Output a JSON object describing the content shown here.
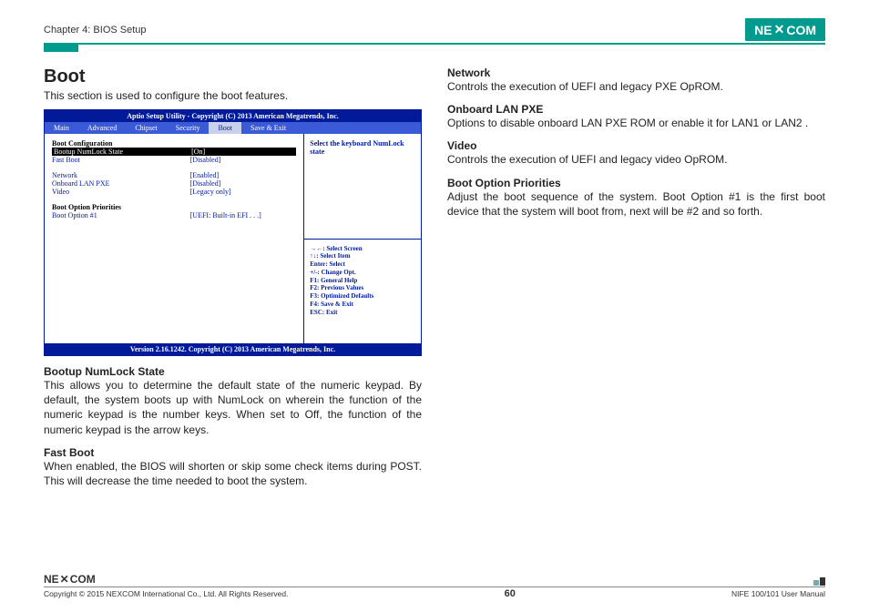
{
  "header": {
    "chapter": "Chapter 4: BIOS Setup",
    "logo_pre": "NE",
    "logo_x": "✕",
    "logo_post": "COM"
  },
  "left": {
    "h1": "Boot",
    "intro": "This section is used to configure the boot features.",
    "numlock_h": "Bootup NumLock State",
    "numlock_b": "This allows you to determine the default state of the numeric keypad. By default, the system boots up with NumLock on wherein the function of the numeric keypad is the number keys. When set to Off, the function of the numeric keypad is the arrow keys.",
    "fastboot_h": "Fast Boot",
    "fastboot_b": "When enabled, the BIOS will shorten or skip some check items during POST. This will decrease the time needed to boot the system."
  },
  "right": {
    "network_h": "Network",
    "network_b": "Controls the execution of UEFI and legacy PXE OpROM.",
    "lanpxe_h": "Onboard LAN PXE",
    "lanpxe_b": "Options to disable onboard LAN PXE ROM or enable it for LAN1 or LAN2 .",
    "video_h": "Video",
    "video_b": "Controls the execution of UEFI and legacy video OpROM.",
    "priorities_h": "Boot Option Priorities",
    "priorities_b": "Adjust the boot sequence of the system. Boot Option #1 is the first boot device that the system will boot from, next will be #2 and so forth."
  },
  "bios": {
    "title": "Aptio Setup Utility - Copyright (C) 2013 American Megatrends, Inc.",
    "tabs": {
      "main": "Main",
      "advanced": "Advanced",
      "chipset": "Chipset",
      "security": "Security",
      "boot": "Boot",
      "save": "Save & Exit"
    },
    "cfg_header": "Boot Configuration",
    "rows": {
      "numlock_k": "Bootup NumLock State",
      "numlock_v": "[On]",
      "fast_k": "Fast Boot",
      "fast_v": "[Disabled]",
      "net_k": "Network",
      "net_v": "[Enabled]",
      "lan_k": "Onboard LAN PXE",
      "lan_v": "[Disabled]",
      "vid_k": "Video",
      "vid_v": "[Legacy only]"
    },
    "prio_header": "Boot Option Priorities",
    "opt1_k": "Boot Option #1",
    "opt1_v": "[UEFI: Built-in EFI . . .]",
    "help": "Select the keyboard NumLock state",
    "keys": {
      "l1": "→←: Select Screen",
      "l2": "↑↓: Select Item",
      "l3": "Enter: Select",
      "l4": "+/-: Change Opt.",
      "l5": "F1: General Help",
      "l6": "F2: Previous Values",
      "l7": "F3: Optimized Defaults",
      "l8": "F4: Save & Exit",
      "l9": "ESC: Exit"
    },
    "version": "Version 2.16.1242. Copyright (C) 2013 American Megatrends, Inc."
  },
  "footer": {
    "copyright": "Copyright © 2015 NEXCOM International Co., Ltd. All Rights Reserved.",
    "page": "60",
    "manual": "NIFE 100/101 User Manual"
  }
}
